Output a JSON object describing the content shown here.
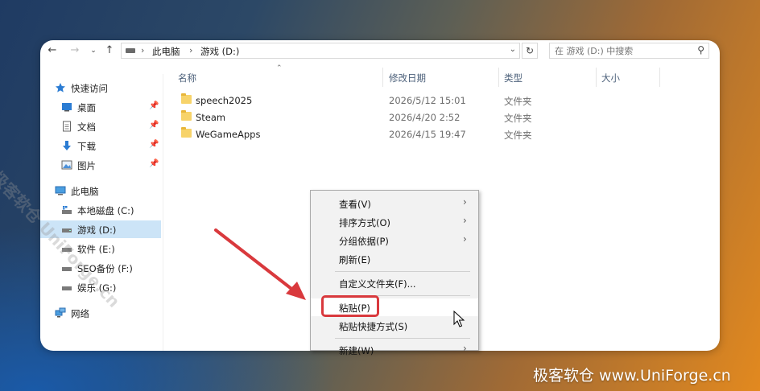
{
  "address_bar": {
    "breadcrumbs": [
      "此电脑",
      "游戏 (D:)"
    ]
  },
  "search": {
    "placeholder": "在 游戏 (D:) 中搜索"
  },
  "sidebar": {
    "items": [
      {
        "label": "快速访问",
        "icon": "star-icon"
      },
      {
        "label": "桌面",
        "icon": "desktop-icon"
      },
      {
        "label": "文档",
        "icon": "document-icon"
      },
      {
        "label": "下载",
        "icon": "download-icon"
      },
      {
        "label": "图片",
        "icon": "pictures-icon"
      },
      {
        "label": "此电脑",
        "icon": "computer-icon"
      },
      {
        "label": "本地磁盘 (C:)",
        "icon": "drive-icon"
      },
      {
        "label": "游戏 (D:)",
        "icon": "drive-icon",
        "selected": true
      },
      {
        "label": "软件 (E:)",
        "icon": "drive-icon"
      },
      {
        "label": "SEO备份 (F:)",
        "icon": "drive-icon"
      },
      {
        "label": "娱乐 (G:)",
        "icon": "drive-icon"
      },
      {
        "label": "网络",
        "icon": "network-icon"
      }
    ]
  },
  "columns": [
    "名称",
    "修改日期",
    "类型",
    "大小"
  ],
  "files": [
    {
      "name": "speech2025",
      "modified": "2026/5/12 15:01",
      "type": "文件夹"
    },
    {
      "name": "Steam",
      "modified": "2026/4/20 2:52",
      "type": "文件夹"
    },
    {
      "name": "WeGameApps",
      "modified": "2026/4/15 19:47",
      "type": "文件夹"
    }
  ],
  "context_menu": {
    "items": [
      {
        "label": "查看(V)",
        "submenu": true
      },
      {
        "label": "排序方式(O)",
        "submenu": true
      },
      {
        "label": "分组依据(P)",
        "submenu": true
      },
      {
        "label": "刷新(E)"
      },
      {
        "label": "自定义文件夹(F)..."
      },
      {
        "label": "粘贴(P)",
        "highlighted": true
      },
      {
        "label": "粘贴快捷方式(S)"
      },
      {
        "label": "新建(W)",
        "submenu": true
      }
    ]
  },
  "annotation": {
    "color": "#d9393d"
  },
  "watermark": {
    "diagonal": "极客软仓 UniForge.cn",
    "bottom": "极客软仓 www.UniForge.cn"
  }
}
